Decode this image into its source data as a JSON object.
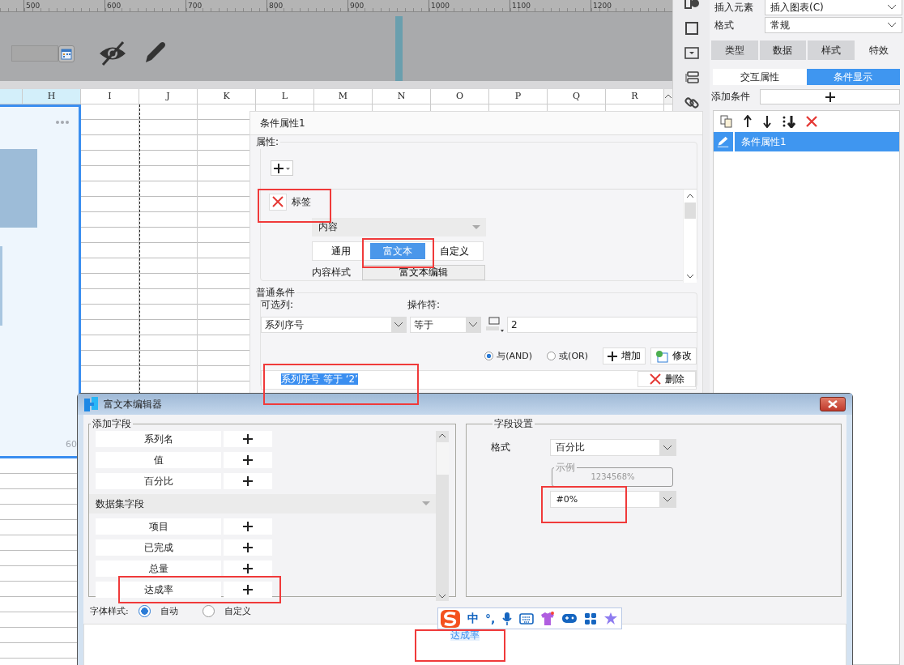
{
  "ruler": {
    "ticks": [
      "500",
      "600",
      "700",
      "800",
      "900",
      "1000",
      "1100",
      "1200"
    ]
  },
  "sheet": {
    "columns": [
      {
        "label": "H",
        "selected": true
      },
      {
        "label": "I",
        "selected": false
      },
      {
        "label": "J",
        "selected": false
      },
      {
        "label": "K",
        "selected": false
      },
      {
        "label": "L",
        "selected": false
      },
      {
        "label": "M",
        "selected": false
      },
      {
        "label": "N",
        "selected": false
      },
      {
        "label": "O",
        "selected": false
      },
      {
        "label": "P",
        "selected": false
      },
      {
        "label": "Q",
        "selected": false
      },
      {
        "label": "R",
        "selected": false
      }
    ],
    "chart": {
      "axis_label": "60"
    }
  },
  "side_panel": {
    "insert": {
      "label": "插入元素",
      "value": "插入图表(C)"
    },
    "format": {
      "label": "格式",
      "value": "常规"
    },
    "tabs": [
      {
        "label": "类型",
        "selected": false
      },
      {
        "label": "数据",
        "selected": false
      },
      {
        "label": "样式",
        "selected": false
      },
      {
        "label": "特效",
        "selected": true
      }
    ],
    "subtabs": [
      {
        "label": "交互属性",
        "selected": false
      },
      {
        "label": "条件显示",
        "selected": true
      }
    ],
    "add_condition": "添加条件",
    "conditions": [
      {
        "name": "条件属性1",
        "selected": true
      }
    ]
  },
  "condition_panel": {
    "title": "条件属性1",
    "properties": {
      "legend": "属性:",
      "items": [
        {
          "label": "标签",
          "content_label": "内容",
          "modes": [
            {
              "label": "通用",
              "selected": false
            },
            {
              "label": "富文本",
              "selected": true
            },
            {
              "label": "自定义",
              "selected": false
            }
          ],
          "style_label": "内容样式",
          "style_button": "富文本编辑"
        }
      ]
    },
    "condition": {
      "legend": "普通条件",
      "column_label": "可选列:",
      "column_value": "系列序号",
      "operator_label": "操作符:",
      "operator_value": "等于",
      "value": "2",
      "logic": [
        {
          "label": "与(AND)",
          "selected": true
        },
        {
          "label": "或(OR)",
          "selected": false
        }
      ],
      "add_button": "增加",
      "edit_button": "修改",
      "rules": [
        {
          "text": "系列序号 等于 ‘2’",
          "selected": true
        }
      ],
      "delete_button": "删除"
    }
  },
  "rich_text_editor": {
    "title": "富文本编辑器",
    "fields_legend": "添加字段",
    "fields": [
      {
        "kind": "field",
        "label": "系列名"
      },
      {
        "kind": "field",
        "label": "值"
      },
      {
        "kind": "field",
        "label": "百分比"
      },
      {
        "kind": "group",
        "label": "数据集字段"
      },
      {
        "kind": "field",
        "label": "项目"
      },
      {
        "kind": "field",
        "label": "已完成"
      },
      {
        "kind": "field",
        "label": "总量"
      },
      {
        "kind": "field",
        "label": "达成率"
      }
    ],
    "settings": {
      "legend": "字段设置",
      "format_label": "格式",
      "format_value": "百分比",
      "example_legend": "示例",
      "example_value": "1234568%",
      "pattern": "#0%"
    },
    "font_style": {
      "label": "字体样式:",
      "options": [
        {
          "label": "自动",
          "selected": true
        },
        {
          "label": "自定义",
          "selected": false
        }
      ]
    },
    "content": "达成率"
  },
  "ime_toolbar": {
    "items": [
      {
        "kind": "logo"
      },
      {
        "kind": "text",
        "text": "中"
      },
      {
        "kind": "text",
        "text": "°,"
      },
      {
        "kind": "mic"
      },
      {
        "kind": "keyboard"
      },
      {
        "kind": "skin"
      },
      {
        "kind": "game"
      },
      {
        "kind": "apps"
      },
      {
        "kind": "star"
      }
    ]
  }
}
